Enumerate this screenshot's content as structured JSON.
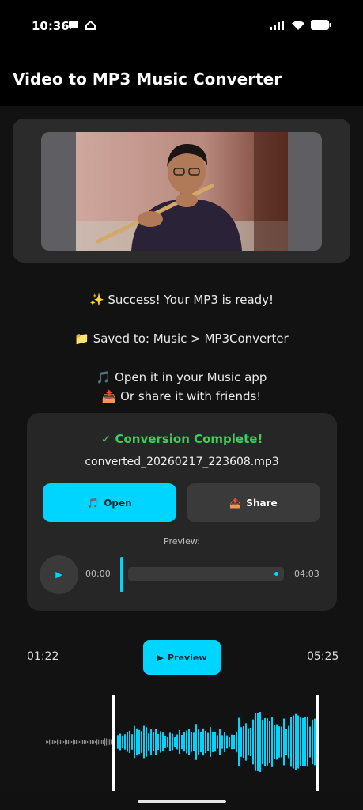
{
  "status": {
    "time": "10:36",
    "left_icons": [
      "chat-bubble-icon",
      "home-outline-icon"
    ],
    "right_icons": [
      "signal-icon",
      "wifi-icon",
      "battery-icon"
    ]
  },
  "app": {
    "title": "Video to MP3 Music Converter"
  },
  "thumbnail": {
    "subject": "man playing bamboo flute"
  },
  "messages": {
    "success": "✨ Success! Your MP3 is ready!",
    "saved": "📁 Saved to: Music > MP3Converter",
    "open_it": "🎵 Open it in your Music app",
    "share_it": "📤 Or share it with friends!"
  },
  "result": {
    "title": "✓ Conversion Complete!",
    "filename": "converted_20260217_223608.mp3",
    "open_icon": "🎵",
    "open_label": "Open",
    "share_icon": "📤",
    "share_label": "Share",
    "preview_label": "Preview:",
    "play_icon": "▶",
    "position": "00:00",
    "duration": "04:03"
  },
  "trim": {
    "start": "01:22",
    "end": "05:25",
    "preview_icon": "▶",
    "preview_label": "Preview"
  },
  "colors": {
    "accent": "#00d5ff",
    "success": "#39d15a",
    "card": "#262626",
    "background": "#121212"
  }
}
